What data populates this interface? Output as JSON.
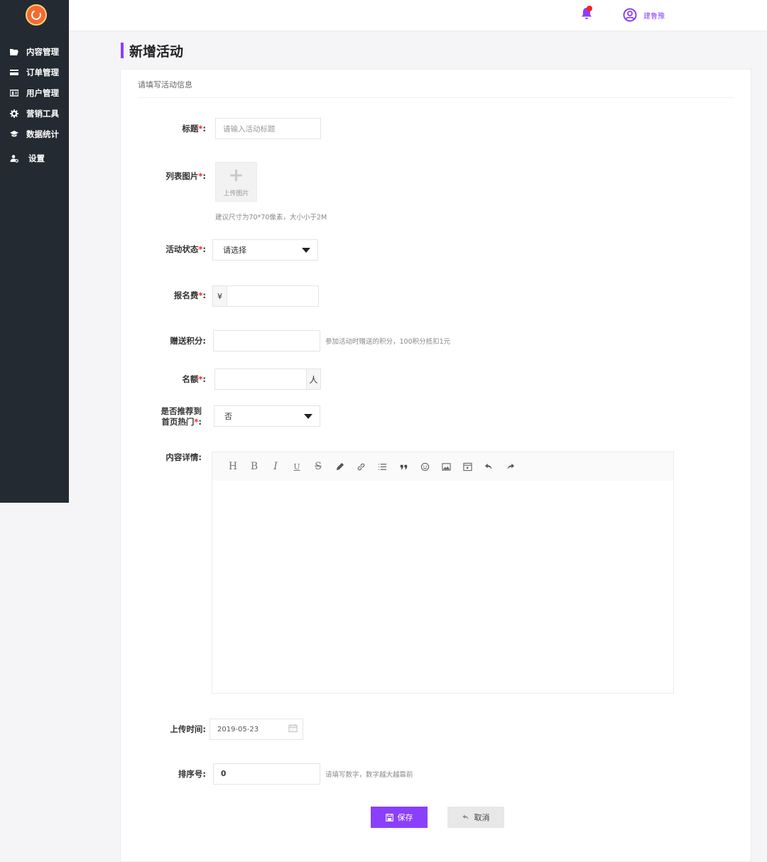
{
  "header": {
    "username": "建鲁豫",
    "notification_icon": "bell-icon",
    "accent": "#8a3ffc"
  },
  "sidebar": {
    "items": [
      {
        "label": "内容管理",
        "icon": "folder-icon"
      },
      {
        "label": "订单管理",
        "icon": "card-icon"
      },
      {
        "label": "用户管理",
        "icon": "id-card-icon"
      },
      {
        "label": "营销工具",
        "icon": "gear-icon"
      },
      {
        "label": "数据统计",
        "icon": "graduation-icon"
      },
      {
        "label": "设置",
        "icon": "user-settings-icon"
      }
    ]
  },
  "page": {
    "title": "新增活动",
    "section_title": "请填写活动信息"
  },
  "form": {
    "title": {
      "label": "标题",
      "placeholder": "请输入活动标题"
    },
    "image": {
      "label": "列表图片",
      "upload_text": "上传图片",
      "hint": "建议尺寸为70*70像素，大小小于2M"
    },
    "status": {
      "label": "活动状态",
      "value": "请选择"
    },
    "fee": {
      "label": "报名费",
      "prefix": "¥",
      "value": ""
    },
    "points": {
      "label": "赠送积分",
      "value": "",
      "hint": "参加活动时赠送的积分，100积分抵扣1元"
    },
    "quota": {
      "label": "名额",
      "suffix": "人",
      "value": ""
    },
    "recommend": {
      "label_line1": "是否推荐到",
      "label_line2": "首页热门",
      "value": "否"
    },
    "content": {
      "label": "内容详情"
    },
    "upload_time": {
      "label": "上传时间",
      "value": "2019-05-23"
    },
    "sort": {
      "label": "排序号",
      "value": "0",
      "hint": "请填写数字，数字越大越靠前"
    },
    "required_mark": "*",
    "colon": ":"
  },
  "editor_toolbar": [
    "H",
    "B",
    "I",
    "U",
    "S",
    "pencil-icon",
    "link-icon",
    "list-icon",
    "quote-icon",
    "emoji-icon",
    "image-icon",
    "video-icon",
    "undo-icon",
    "redo-icon"
  ],
  "buttons": {
    "save": "保存",
    "cancel": "取消"
  }
}
